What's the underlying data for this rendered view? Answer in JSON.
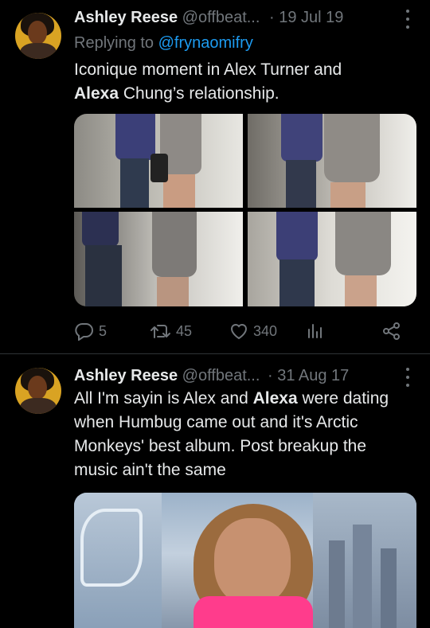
{
  "tweets": [
    {
      "author": {
        "name": "Ashley Reese",
        "handle": "@offbeat...",
        "separator": "·",
        "date": "19 Jul 19"
      },
      "reply": {
        "prefix": "Replying to ",
        "handle": "@frynaomifry"
      },
      "text": {
        "part1": "Iconique moment in Alex Turner and ",
        "bold1": "Alexa",
        "part2": " Chung’s relationship."
      },
      "actions": {
        "replies": "5",
        "retweets": "45",
        "likes": "340"
      }
    },
    {
      "author": {
        "name": "Ashley Reese",
        "handle": "@offbeat...",
        "separator": "·",
        "date": "31 Aug 17"
      },
      "text": {
        "line1a": "All I'm sayin is Alex and ",
        "bold1": "Alexa",
        "line1b": " were dating",
        "line2": "when Humbug came out and it's Arctic",
        "line3": "Monkeys' best album. Post breakup the",
        "line4": "music ain't the same"
      }
    }
  ],
  "icons": [
    "more-icon",
    "reply-icon",
    "retweet-icon",
    "like-icon",
    "views-icon",
    "share-icon"
  ],
  "colors": {
    "background": "#000000",
    "text": "#e7e9ea",
    "muted": "#71767b",
    "link": "#1d9bf0",
    "divider": "#2f3336"
  }
}
